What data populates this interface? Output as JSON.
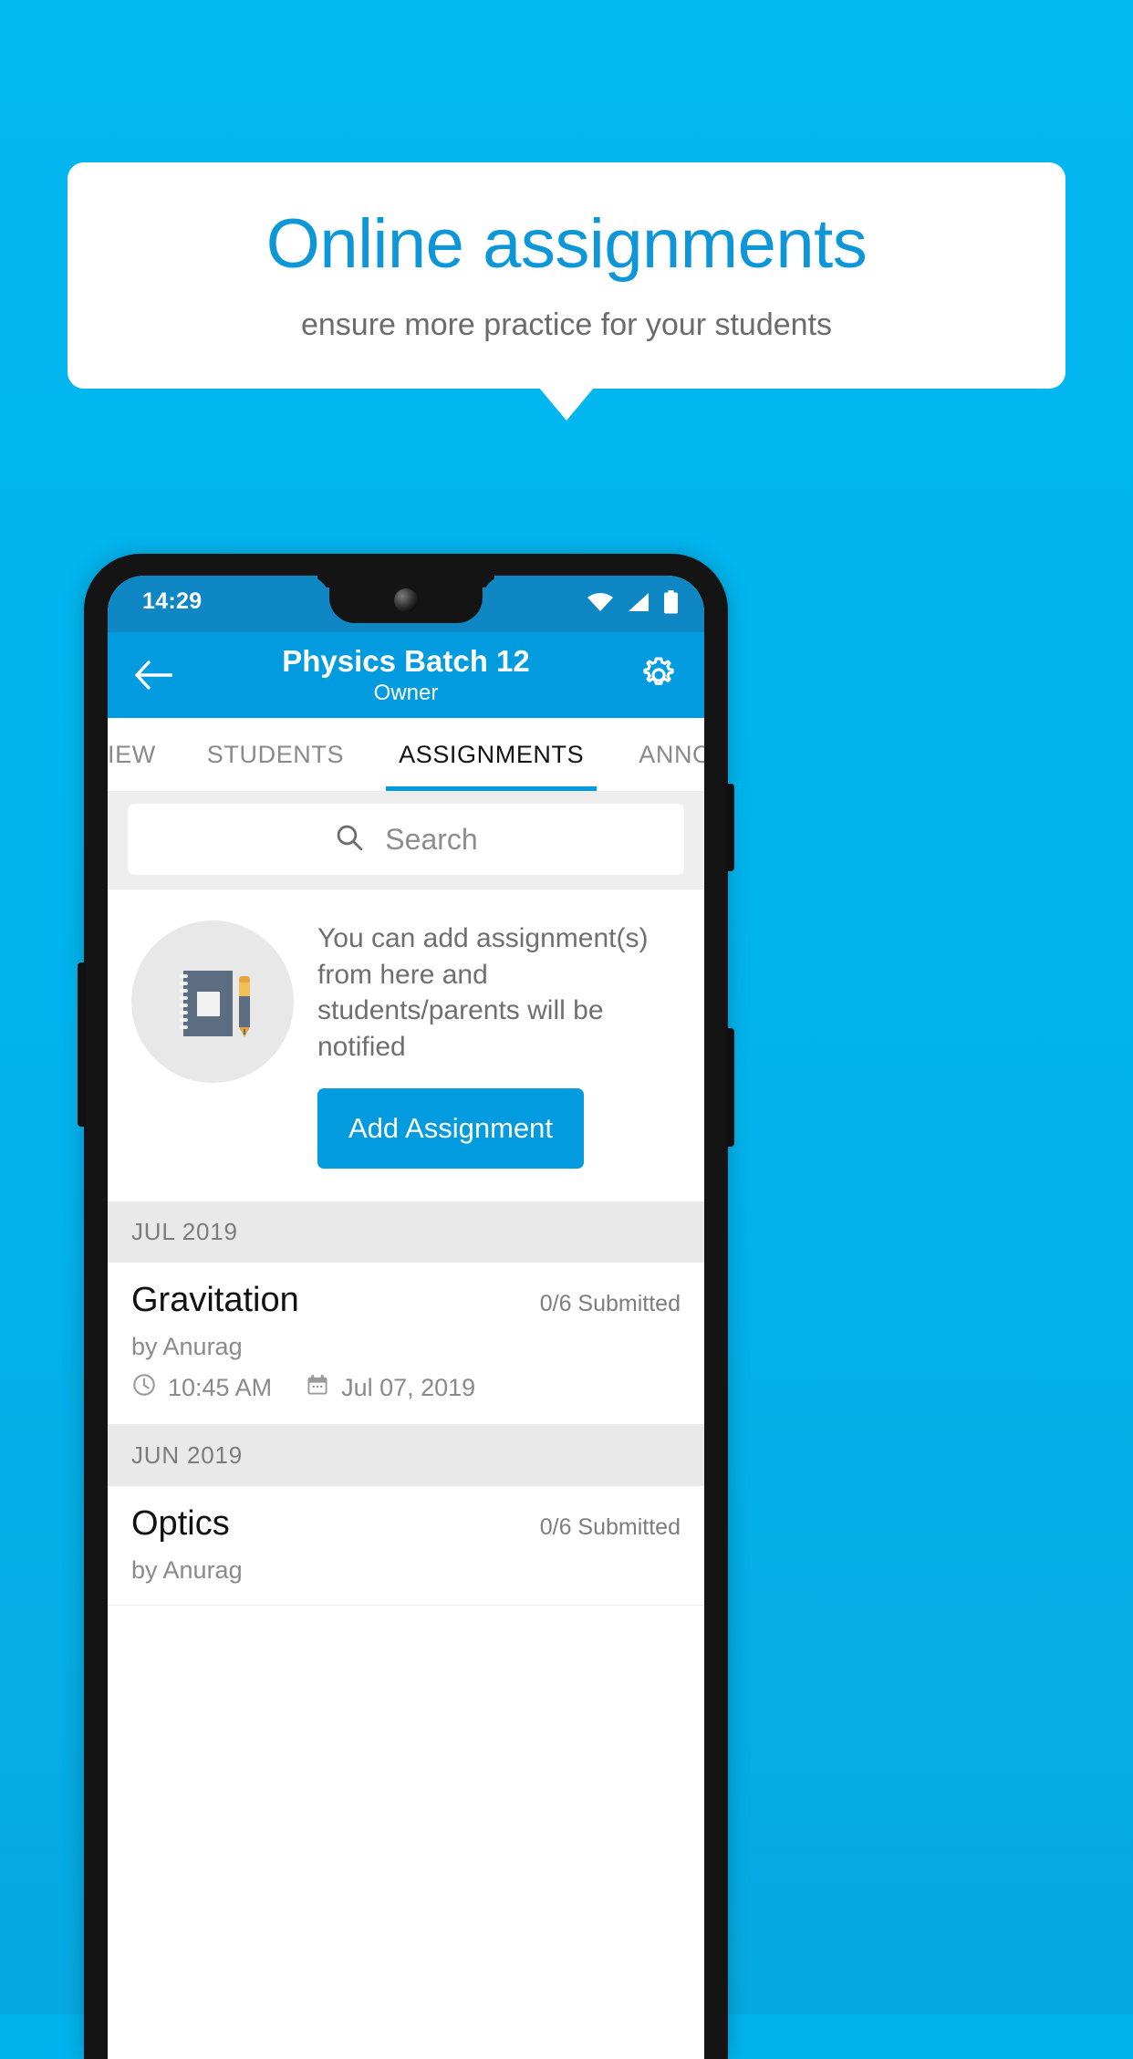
{
  "promo": {
    "title": "Online assignments",
    "subtitle": "ensure more practice for your students",
    "accent_color": "#0d97d8",
    "background_color": "#03b7f0"
  },
  "phone": {
    "status_bar": {
      "time": "14:29",
      "icons": [
        "wifi-icon",
        "signal-icon",
        "battery-icon"
      ],
      "background_color": "#0e87c4"
    },
    "app_bar": {
      "back_icon": "back-arrow-icon",
      "title": "Physics Batch 12",
      "subtitle": "Owner",
      "settings_icon": "gear-icon",
      "background_color": "#039be0"
    },
    "tabs": [
      {
        "label": "IEW",
        "active": false,
        "partial": true
      },
      {
        "label": "STUDENTS",
        "active": false,
        "partial": false
      },
      {
        "label": "ASSIGNMENTS",
        "active": true,
        "partial": false
      },
      {
        "label": "ANNOUNCEM",
        "active": false,
        "partial": true
      }
    ],
    "search": {
      "icon": "search-icon",
      "placeholder": "Search",
      "value": ""
    },
    "empty_state": {
      "illustration": "notebook-and-pen-icon",
      "message": "You can add assignment(s) from here and students/parents will be notified",
      "button_label": "Add Assignment",
      "button_color": "#039be0"
    },
    "sections": [
      {
        "month": "JUL 2019",
        "assignments": [
          {
            "title": "Gravitation",
            "submitted": "0/6 Submitted",
            "author": "by Anurag",
            "time_icon": "clock-icon",
            "time": "10:45 AM",
            "date_icon": "calendar-icon",
            "date": "Jul 07, 2019"
          }
        ]
      },
      {
        "month": "JUN 2019",
        "assignments": [
          {
            "title": "Optics",
            "submitted": "0/6 Submitted",
            "author": "by Anurag",
            "time_icon": "clock-icon",
            "time": "",
            "date_icon": "calendar-icon",
            "date": ""
          }
        ]
      }
    ]
  }
}
